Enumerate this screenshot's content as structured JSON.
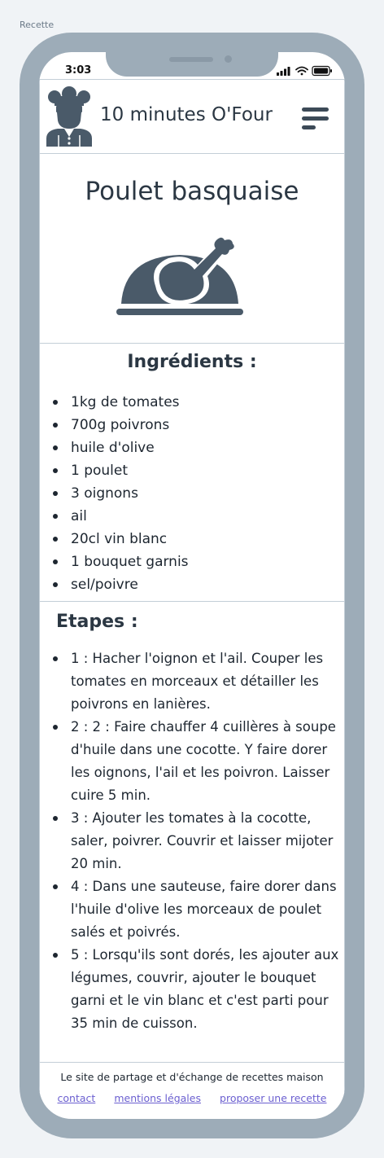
{
  "frame": {
    "label": "Recette"
  },
  "status": {
    "time": "3:03"
  },
  "header": {
    "site_title": "10 minutes O'Four"
  },
  "recipe": {
    "title": "Poulet basquaise"
  },
  "ingredients": {
    "heading": "Ingrédients :",
    "items": [
      "1kg de tomates",
      "700g poivrons",
      "huile d'olive",
      "1 poulet",
      "3 oignons",
      "ail",
      "20cl vin blanc",
      "1 bouquet garnis",
      "sel/poivre"
    ]
  },
  "steps": {
    "heading": "Etapes :",
    "items": [
      "1 : Hacher l'oignon et l'ail. Couper les tomates en morceaux et détailler les poivrons en lanières.",
      "2 :  2 : Faire chauffer 4 cuillères à soupe d'huile dans une cocotte. Y faire dorer les oignons, l'ail et les poivron. Laisser cuire 5 min.",
      "3 : Ajouter les tomates à la cocotte, saler, poivrer. Couvrir et laisser mijoter 20 min.",
      "4 : Dans une sauteuse, faire dorer dans l'huile d'olive les morceaux de poulet salés et poivrés.",
      "5 : Lorsqu'ils sont dorés, les ajouter aux légumes, couvrir, ajouter le bouquet garni et le vin blanc et c'est parti pour 35 min de cuisson."
    ]
  },
  "footer": {
    "tagline": "Le site de partage et d'échange de recettes maison",
    "links": {
      "contact": "contact",
      "legal": "mentions légales",
      "propose": "proposer une recette"
    }
  },
  "colors": {
    "primary": "#4a5a69",
    "frame": "#9dacb8",
    "link": "#6b5fd0",
    "background": "#f0f3f6"
  },
  "icons": {
    "logo": "chef-icon",
    "menu": "hamburger-menu-icon",
    "dish": "roast-chicken-icon"
  }
}
